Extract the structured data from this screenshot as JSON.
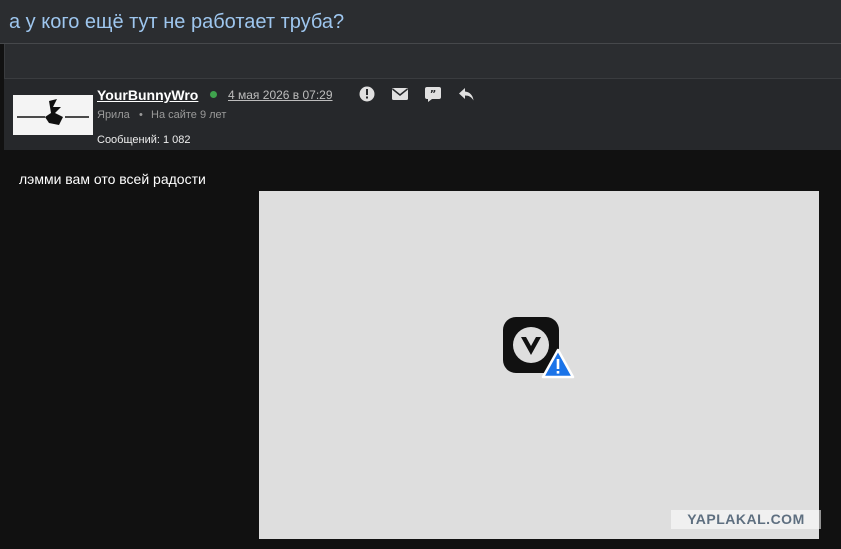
{
  "topic": {
    "title": "а у кого ещё тут не работает труба?"
  },
  "post": {
    "username": "YourBunnyWro",
    "date": "4 мая 2026 в 07:29",
    "rank": "Ярила",
    "separator": "•",
    "on_site": "На сайте 9 лет",
    "messages": "Сообщений: 1 082",
    "text": "лэмми вам ото всей радости",
    "online_color": "#3fa34d"
  },
  "actions": {
    "icons": [
      "report-icon",
      "mail-icon",
      "quote-icon",
      "reply-icon"
    ]
  },
  "image": {
    "state": "broken",
    "icon": "vivaldi-warning-icon",
    "watermark": "YAPLAKAL.COM"
  },
  "colors": {
    "title": "#9ec6ee",
    "header_bg": "#2b2d30",
    "post_bg": "#111111",
    "image_bg": "#dedede"
  }
}
